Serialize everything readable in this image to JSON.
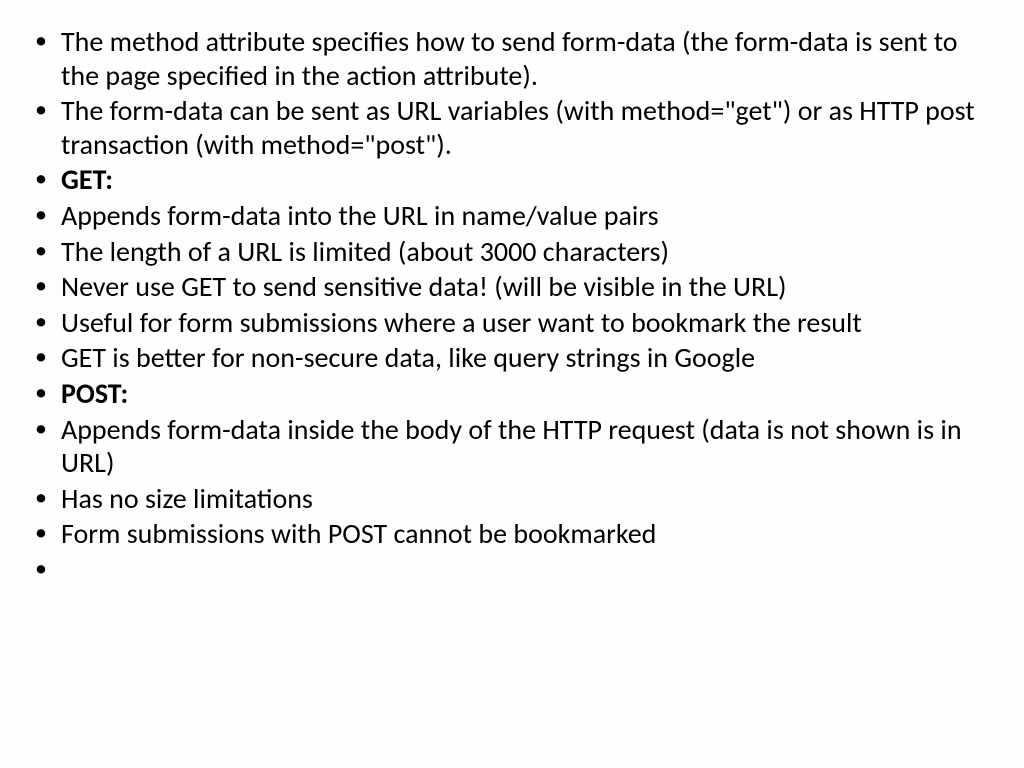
{
  "bullets": [
    {
      "text": "The method attribute specifies how to send form-data (the form-data is sent to the page specified in the action attribute).",
      "bold": false
    },
    {
      "text": "The form-data can be sent as URL variables (with method=\"get\") or as HTTP post transaction (with method=\"post\").",
      "bold": false
    },
    {
      "text": " GET:",
      "bold": true
    },
    {
      "text": "Appends form-data into the URL in name/value pairs",
      "bold": false
    },
    {
      "text": "The length of a URL is limited (about 3000 characters)",
      "bold": false
    },
    {
      "text": "Never use GET to send sensitive data! (will be visible in the URL)",
      "bold": false
    },
    {
      "text": "Useful for form submissions where a user want to bookmark the result",
      "bold": false
    },
    {
      "text": "GET is better for non-secure data, like query strings in Google",
      "bold": false
    },
    {
      "text": "POST:",
      "bold": true
    },
    {
      "text": "Appends form-data inside the body of the HTTP request (data is not shown is in URL)",
      "bold": false
    },
    {
      "text": "Has no size limitations",
      "bold": false
    },
    {
      "text": "Form submissions with POST cannot be bookmarked",
      "bold": false
    },
    {
      "text": "",
      "bold": false
    }
  ]
}
